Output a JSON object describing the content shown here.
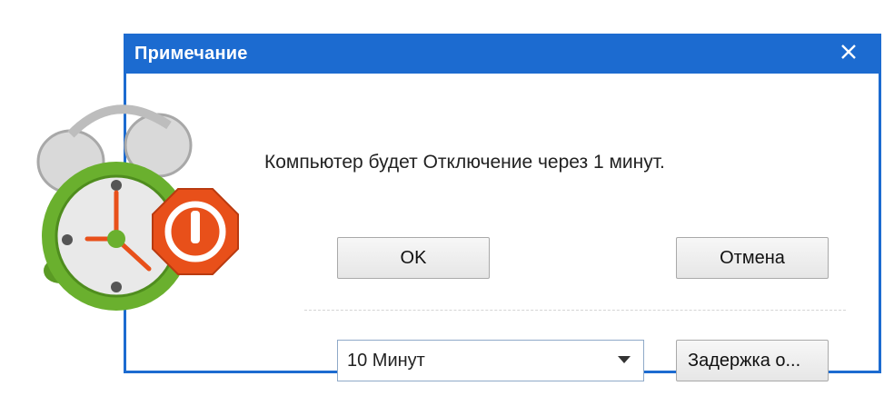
{
  "dialog": {
    "title": "Примечание",
    "close_icon": "close-icon",
    "message": "Компьютер будет Отключение через 1 минут.",
    "ok_label": "OK",
    "cancel_label": "Отмена",
    "delay_select": {
      "selected": "10 Минут"
    },
    "delay_button_label": "Задержка о..."
  },
  "app_icon": {
    "name": "alarm-clock-power-icon",
    "clock_color": "#6ab02e",
    "power_badge_color": "#e8501a"
  },
  "colors": {
    "titlebar": "#1c6bd0",
    "title_text": "#ffffff",
    "accent_power": "#e8501a",
    "clock_green": "#6ab02e"
  }
}
